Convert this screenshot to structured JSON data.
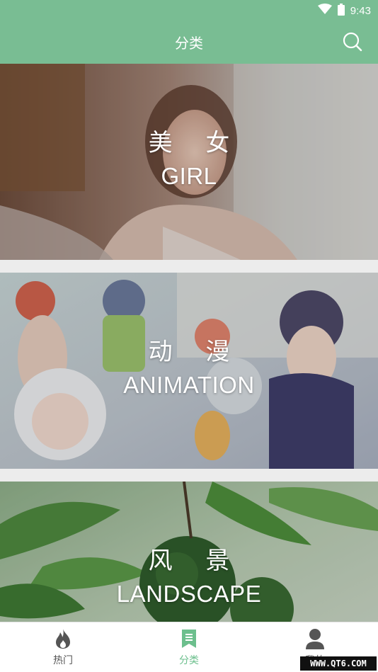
{
  "status_bar": {
    "time": "9:43"
  },
  "header": {
    "title": "分类",
    "search_icon": "search-icon"
  },
  "categories": [
    {
      "cn": "美 女",
      "en": "GIRL"
    },
    {
      "cn": "动 漫",
      "en": "ANIMATION"
    },
    {
      "cn": "风 景",
      "en": "LANDSCAPE"
    }
  ],
  "bottom_nav": {
    "items": [
      {
        "label": "热门",
        "icon": "flame-icon"
      },
      {
        "label": "分类",
        "icon": "bookmark-list-icon",
        "active": true
      },
      {
        "label": "我的",
        "icon": "person-icon"
      }
    ]
  },
  "watermark": "WWW.QT6.COM",
  "colors": {
    "accent": "#79bd93",
    "nav_active": "#6cbf8d",
    "background": "#ececec"
  }
}
